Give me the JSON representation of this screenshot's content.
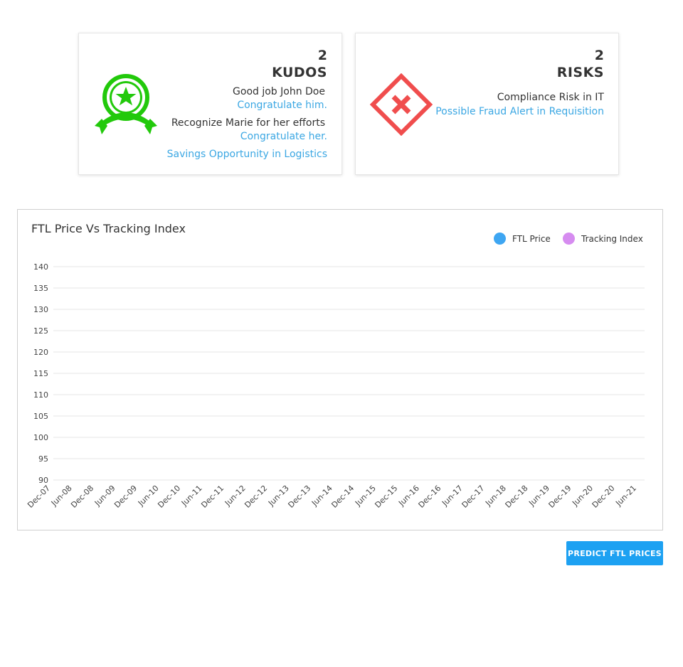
{
  "kudos": {
    "count": "2",
    "title": "KUDOS",
    "items": [
      {
        "text": "Good job John Doe",
        "link": "Congratulate him."
      },
      {
        "text": "Recognize Marie for her efforts",
        "link": "Congratulate her."
      }
    ],
    "extra_link": "Savings Opportunity in Logistics",
    "icon": "award-ribbon-icon",
    "color": "#22c90b"
  },
  "risks": {
    "count": "2",
    "title": "RISKS",
    "text": "Compliance Risk in IT",
    "link": "Possible Fraud Alert in Requisition",
    "icon": "warning-diamond-x-icon",
    "color": "#f04d4d"
  },
  "colors": {
    "link": "#3ba7e3",
    "button": "#1da1f2",
    "ftl_price": "#3ea6f2",
    "tracking_index": "#d68cf0"
  },
  "chart_data": {
    "type": "line",
    "title": "FTL Price Vs Tracking Index",
    "legend_position": "top-right",
    "grid": true,
    "series": [
      {
        "name": "FTL Price",
        "values": []
      },
      {
        "name": "Tracking Index",
        "values": []
      }
    ],
    "yticks": [
      "140",
      "135",
      "130",
      "125",
      "120",
      "115",
      "110",
      "105",
      "100",
      "95",
      "90"
    ],
    "ylim": [
      90,
      140
    ],
    "categories": [
      "Dec-07",
      "Jun-08",
      "Dec-08",
      "Jun-09",
      "Dec-09",
      "Jun-10",
      "Dec-10",
      "Jun-11",
      "Dec-11",
      "Jun-12",
      "Dec-12",
      "Jun-13",
      "Dec-13",
      "Jun-14",
      "Dec-14",
      "Jun-15",
      "Dec-15",
      "Jun-16",
      "Dec-16",
      "Jun-17",
      "Dec-17",
      "Jun-18",
      "Dec-18",
      "Jun-19",
      "Dec-19",
      "Jun-20",
      "Dec-20",
      "Jun-21"
    ]
  },
  "predict_button": {
    "label": "PREDICT FTL PRICES"
  }
}
